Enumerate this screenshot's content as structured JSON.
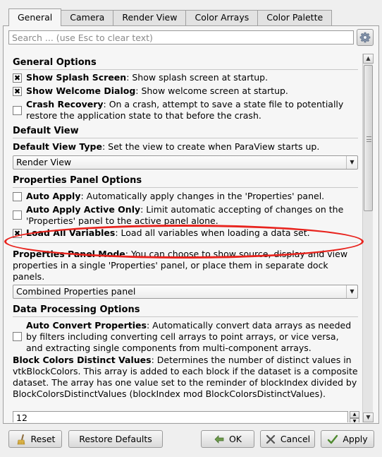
{
  "tabs": [
    {
      "label": "General",
      "active": true
    },
    {
      "label": "Camera"
    },
    {
      "label": "Render View"
    },
    {
      "label": "Color Arrays"
    },
    {
      "label": "Color Palette"
    }
  ],
  "search": {
    "placeholder": "Search ... (use Esc to clear text)"
  },
  "sections": {
    "general_options": "General Options",
    "default_view": "Default View",
    "properties_panel_options": "Properties Panel Options",
    "data_processing_options": "Data Processing Options"
  },
  "settings": {
    "show_splash": {
      "name": "Show Splash Screen",
      "desc": ": Show splash screen at startup.",
      "checked": true
    },
    "show_welcome": {
      "name": "Show Welcome Dialog",
      "desc": ": Show welcome screen at startup.",
      "checked": true
    },
    "crash_recovery": {
      "name": "Crash Recovery",
      "desc": ": On a crash, attempt to save a state file to potentially restore the application state to that before the crash.",
      "checked": false
    },
    "default_view_type": {
      "name": "Default View Type",
      "desc": ": Set the view to create when ParaView starts up.",
      "value": "Render View"
    },
    "auto_apply": {
      "name": "Auto Apply",
      "desc": ": Automatically apply changes in the 'Properties' panel.",
      "checked": false
    },
    "auto_apply_active_only": {
      "name": "Auto Apply Active Only",
      "desc": ": Limit automatic accepting of changes on the 'Properties' panel to the active panel alone.",
      "checked": false
    },
    "load_all_variables": {
      "name": "Load All Variables",
      "desc": ": Load all variables when loading a data set.",
      "checked": true
    },
    "properties_panel_mode": {
      "name": "Properties Panel Mode",
      "desc": ": You can choose to show source, display and view properties in a single 'Properties' panel, or place them in separate dock panels.",
      "value": "Combined Properties panel"
    },
    "auto_convert": {
      "name": "Auto Convert Properties",
      "desc": ": Automatically convert data arrays as needed by filters including converting cell arrays to point arrays, or vice versa, and extracting single components from multi-component arrays.",
      "checked": false
    },
    "block_colors": {
      "name": "Block Colors Distinct Values",
      "desc": ": Determines the number of distinct values in vtkBlockColors. This array is added to each block if the dataset is a composite dataset. The array has one value set to the reminder of blockIndex divided by BlockColorsDistinctValues (blockIndex mod BlockColorsDistinctValues).",
      "value": "12"
    }
  },
  "check_mark": "✖",
  "buttons": {
    "reset": "Reset",
    "restore_defaults": "Restore Defaults",
    "ok": "OK",
    "cancel": "Cancel",
    "apply": "Apply"
  },
  "colors": {
    "highlight": "#e8231d"
  }
}
